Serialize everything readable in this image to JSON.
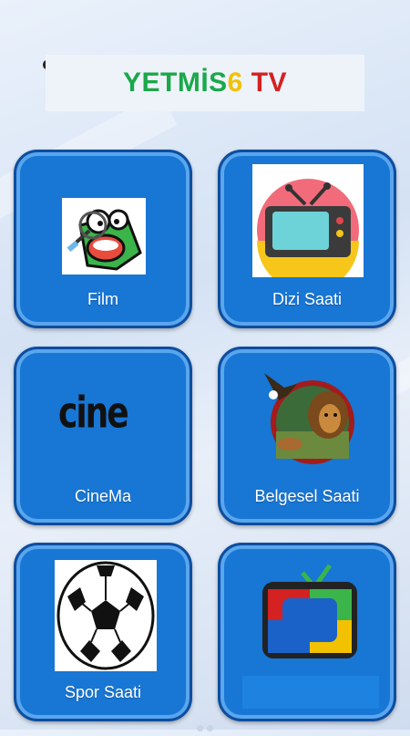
{
  "app": {
    "title_parts": [
      "YETM",
      "İS",
      "6",
      " TV"
    ],
    "title_colors": [
      "#1aa84a",
      "#f2c200",
      "#d42121"
    ]
  },
  "tiles": [
    {
      "label": "Film",
      "icon": "cartoon-frog-icon"
    },
    {
      "label": "Dizi Saati",
      "icon": "retro-tv-icon"
    },
    {
      "label": "CineMa",
      "icon": "cine-text-icon"
    },
    {
      "label": "Belgesel Saati",
      "icon": "wildlife-icon"
    },
    {
      "label": "Spor Saati",
      "icon": "soccer-ball-icon"
    },
    {
      "label": "",
      "icon": "colorful-tv-icon"
    }
  ],
  "logo_text": {
    "cine": "cine"
  },
  "colors": {
    "tile": "#1876d4",
    "tile_border": "#0d4e9f"
  }
}
